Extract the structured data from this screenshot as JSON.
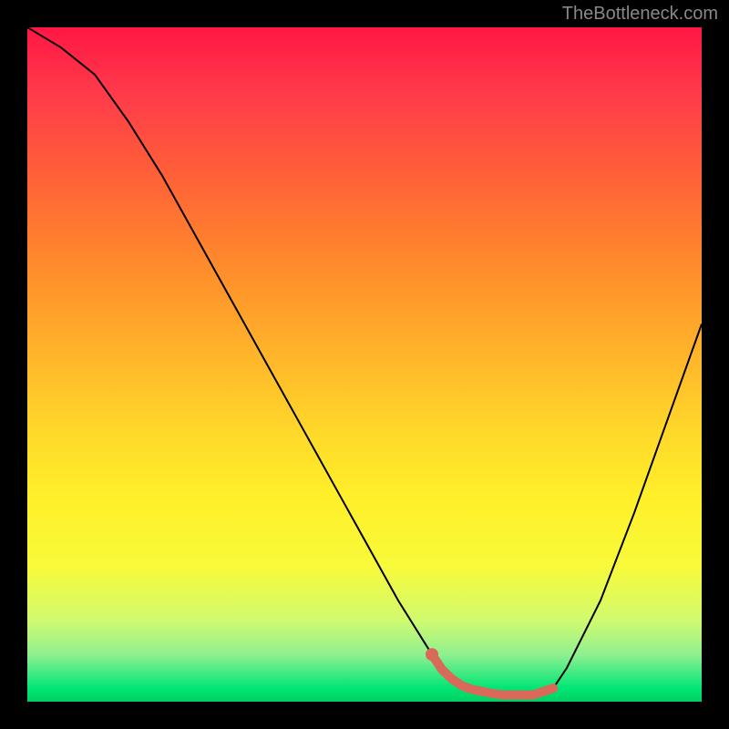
{
  "attribution": "TheBottleneck.com",
  "chart_data": {
    "type": "line",
    "title": "",
    "xlabel": "",
    "ylabel": "",
    "xlim": [
      0,
      100
    ],
    "ylim": [
      0,
      100
    ],
    "series": [
      {
        "name": "bottleneck-curve",
        "x": [
          0,
          5,
          10,
          15,
          20,
          25,
          30,
          35,
          40,
          45,
          50,
          55,
          60,
          62,
          65,
          70,
          75,
          78,
          80,
          85,
          90,
          95,
          100
        ],
        "y": [
          100,
          97,
          93,
          86,
          78,
          69,
          60,
          51,
          42,
          33,
          24,
          15,
          7,
          4,
          2,
          1,
          1,
          2,
          5,
          15,
          28,
          42,
          56
        ]
      }
    ],
    "highlight": {
      "name": "optimal-range",
      "x_start": 60,
      "x_end": 78,
      "dot_x": 60
    },
    "background": "heatmap-gradient-vertical",
    "gradient_stops": [
      {
        "pos": 0,
        "color": "#ff1744"
      },
      {
        "pos": 50,
        "color": "#ffd82a"
      },
      {
        "pos": 100,
        "color": "#00d060"
      }
    ]
  }
}
